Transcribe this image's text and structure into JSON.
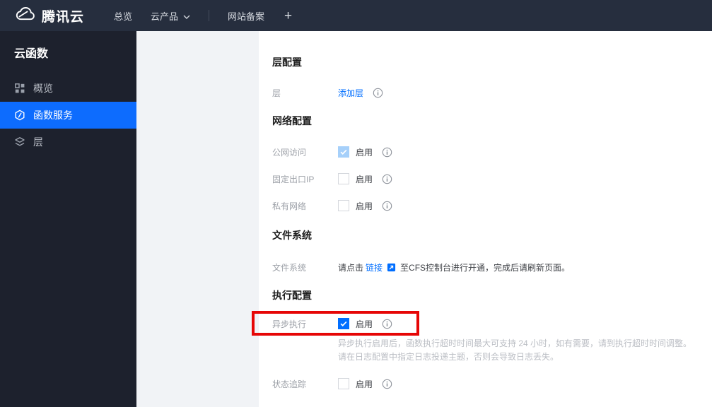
{
  "topbar": {
    "brand": "腾讯云",
    "nav_overview": "总览",
    "nav_products": "云产品",
    "nav_icp": "网站备案",
    "plus": "+"
  },
  "sidebar": {
    "title": "云函数",
    "items": [
      {
        "label": "概览",
        "icon": "grid-icon",
        "active": false
      },
      {
        "label": "函数服务",
        "icon": "function-icon",
        "active": true
      },
      {
        "label": "层",
        "icon": "layers-icon",
        "active": false
      }
    ]
  },
  "content": {
    "layer_section": {
      "heading": "层配置",
      "row_label": "层",
      "add_layer_link": "添加层"
    },
    "network_section": {
      "heading": "网络配置",
      "rows": [
        {
          "label": "公网访问",
          "toggle": "启用",
          "checked": true,
          "disabled": true
        },
        {
          "label": "固定出口IP",
          "toggle": "启用",
          "checked": false,
          "disabled": false
        },
        {
          "label": "私有网络",
          "toggle": "启用",
          "checked": false,
          "disabled": false
        }
      ]
    },
    "filesystem_section": {
      "heading": "文件系统",
      "row_label": "文件系统",
      "text_before": "请点击",
      "link": "链接",
      "text_after": "至CFS控制台进行开通，完成后请刷新页面。"
    },
    "execution_section": {
      "heading": "执行配置",
      "async_row": {
        "label": "异步执行",
        "toggle": "启用",
        "checked": true
      },
      "desc_line1": "异步执行启用后，函数执行超时时间最大可支持 24 小时，如有需要，请到执行超时时间调整。",
      "desc_line2": "请在日志配置中指定日志投递主题，否则会导致日志丢失。",
      "trace_row": {
        "label": "状态追踪",
        "toggle": "启用",
        "checked": false
      }
    }
  },
  "colors": {
    "accent_blue": "#006eff",
    "sidebar_active_blue": "#0d6cfe",
    "topbar_bg": "#262e3e",
    "sidebar_bg": "#1d212d",
    "highlight_red": "#e60606",
    "disabled_checked_blue": "#a6d0fa"
  }
}
